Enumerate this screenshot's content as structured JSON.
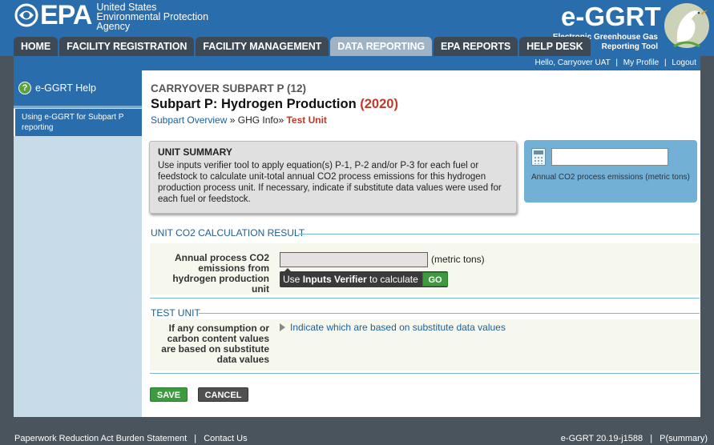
{
  "header": {
    "epa_text": [
      "United States",
      "Environmental Protection",
      "Agency"
    ],
    "epa_mark": "EPA",
    "app_title": "e-GGRT",
    "app_subtitle": [
      "Electronic Greenhouse Gas",
      "Reporting Tool"
    ]
  },
  "nav": {
    "tabs": [
      {
        "label": "HOME"
      },
      {
        "label": "FACILITY REGISTRATION"
      },
      {
        "label": "FACILITY MANAGEMENT"
      },
      {
        "label": "DATA REPORTING"
      },
      {
        "label": "EPA REPORTS"
      },
      {
        "label": "HELP DESK"
      }
    ],
    "active_tab": "DATA REPORTING"
  },
  "userbar": {
    "greeting": "Hello, Carryover UAT",
    "my_profile": "My Profile",
    "logout": "Logout"
  },
  "sidebar": {
    "title": "e-GGRT Help",
    "items": [
      {
        "label": "Using e-GGRT for Subpart P reporting"
      }
    ]
  },
  "main": {
    "kicker": "CARRYOVER SUBPART P (12)",
    "title": "Subpart P: Hydrogen Production",
    "year": "(2020)",
    "breadcrumb": {
      "overview": "Subpart Overview",
      "sep": "»",
      "ghg_info": "GHG Info",
      "current": "Test Unit"
    },
    "summary": {
      "heading": "UNIT SUMMARY",
      "body": "Use inputs verifier tool to apply equation(s) P-1, P-2 and/or P-3 for each fuel or feedstock to calculate unit-total annual CO2 process emissions for this hydrogen production process unit. If necessary, indicate if substitute data values were used for each fuel or feedstock."
    },
    "emissions_box": {
      "value": "",
      "label": "Annual CO2 process emissions (metric tons)"
    },
    "result_section": {
      "title": "UNIT CO2 CALCULATION RESULT",
      "field_label": "Annual process CO2 emissions from hydrogen production unit",
      "value": "",
      "unit": "(metric tons)",
      "verifier_prefix": "Use ",
      "verifier_bold": "Inputs Verifier",
      "verifier_suffix": " to calculate",
      "go_label": "GO"
    },
    "test_section": {
      "title": "TEST UNIT",
      "field_label": "If any consumption or carbon content values are based on substitute data values",
      "link": "Indicate which are based on substitute data values"
    },
    "buttons": {
      "save": "SAVE",
      "cancel": "CANCEL"
    }
  },
  "footer": {
    "paperwork": "Paperwork Reduction Act Burden Statement",
    "contact": "Contact Us",
    "version": "e-GGRT 20.19-j1588",
    "page_code": "P(summary)"
  },
  "colors": {
    "brand_blue": "#2a6dac",
    "year_red": "#c0392b",
    "go_green": "#3c9b3c"
  }
}
